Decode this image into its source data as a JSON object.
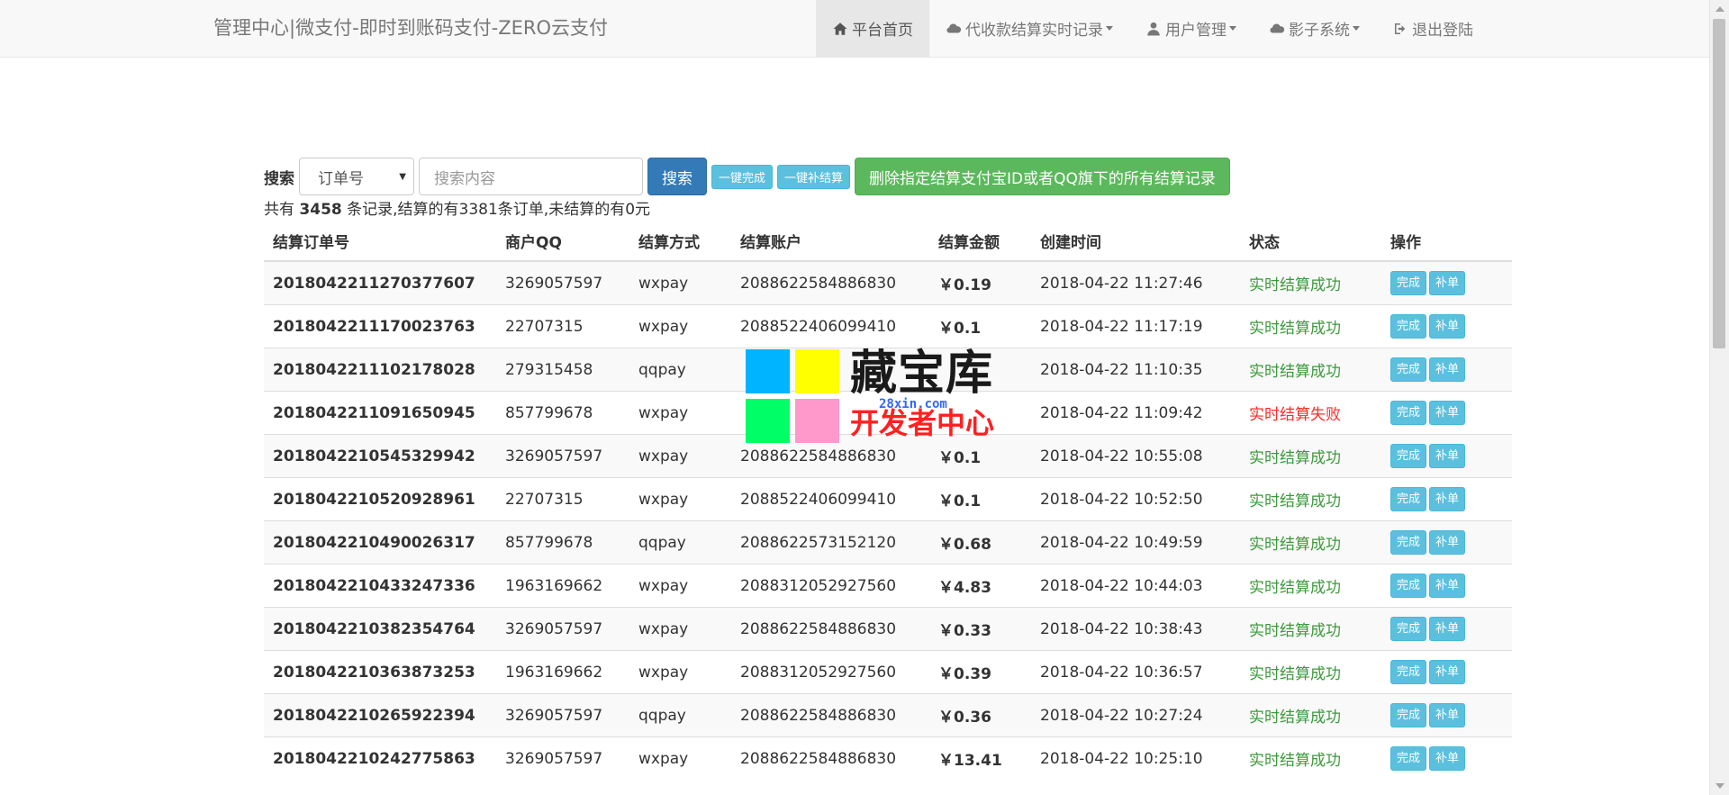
{
  "navbar": {
    "brand": "管理中心|微支付-即时到账码支付-ZERO云支付",
    "items": [
      {
        "label": "平台首页",
        "icon": "home-icon",
        "active": true,
        "dropdown": false
      },
      {
        "label": "代收款结算实时记录",
        "icon": "cloud-icon",
        "active": false,
        "dropdown": true
      },
      {
        "label": "用户管理",
        "icon": "user-icon",
        "active": false,
        "dropdown": true
      },
      {
        "label": "影子系统",
        "icon": "cloud-icon",
        "active": false,
        "dropdown": true
      },
      {
        "label": "退出登陆",
        "icon": "logout-icon",
        "active": false,
        "dropdown": false
      }
    ]
  },
  "search": {
    "label": "搜索",
    "select_value": "订单号",
    "placeholder": "搜索内容",
    "search_button": "搜索",
    "complete_all_button": "一键完成",
    "resettle_all_button": "一键补结算",
    "delete_button": "删除指定结算支付宝ID或者QQ旗下的所有结算记录"
  },
  "summary": {
    "prefix": "共有 ",
    "count": "3458",
    "suffix": " 条记录,结算的有3381条订单,未结算的有0元"
  },
  "table": {
    "headers": [
      "结算订单号",
      "商户QQ",
      "结算方式",
      "结算账户",
      "结算金额",
      "创建时间",
      "状态",
      "操作"
    ],
    "complete_label": "完成",
    "resettle_label": "补单",
    "rows": [
      {
        "order": "2018042211270377607",
        "qq": "3269057597",
        "method": "wxpay",
        "account": "2088622584886830",
        "amount": "￥0.19",
        "time": "2018-04-22 11:27:46",
        "status": "实时结算成功",
        "ok": true
      },
      {
        "order": "2018042211170023763",
        "qq": "22707315",
        "method": "wxpay",
        "account": "2088522406099410",
        "amount": "￥0.1",
        "time": "2018-04-22 11:17:19",
        "status": "实时结算成功",
        "ok": true
      },
      {
        "order": "2018042211102178028",
        "qq": "279315458",
        "method": "qqpay",
        "account": "",
        "amount": "",
        "time": "2018-04-22 11:10:35",
        "status": "实时结算成功",
        "ok": true
      },
      {
        "order": "2018042211091650945",
        "qq": "857799678",
        "method": "wxpay",
        "account": "",
        "amount": "",
        "time": "2018-04-22 11:09:42",
        "status": "实时结算失败",
        "ok": false
      },
      {
        "order": "2018042210545329942",
        "qq": "3269057597",
        "method": "wxpay",
        "account": "2088622584886830",
        "amount": "￥0.1",
        "time": "2018-04-22 10:55:08",
        "status": "实时结算成功",
        "ok": true
      },
      {
        "order": "2018042210520928961",
        "qq": "22707315",
        "method": "wxpay",
        "account": "2088522406099410",
        "amount": "￥0.1",
        "time": "2018-04-22 10:52:50",
        "status": "实时结算成功",
        "ok": true
      },
      {
        "order": "2018042210490026317",
        "qq": "857799678",
        "method": "qqpay",
        "account": "2088622573152120",
        "amount": "￥0.68",
        "time": "2018-04-22 10:49:59",
        "status": "实时结算成功",
        "ok": true
      },
      {
        "order": "2018042210433247336",
        "qq": "1963169662",
        "method": "wxpay",
        "account": "2088312052927560",
        "amount": "￥4.83",
        "time": "2018-04-22 10:44:03",
        "status": "实时结算成功",
        "ok": true
      },
      {
        "order": "2018042210382354764",
        "qq": "3269057597",
        "method": "wxpay",
        "account": "2088622584886830",
        "amount": "￥0.33",
        "time": "2018-04-22 10:38:43",
        "status": "实时结算成功",
        "ok": true
      },
      {
        "order": "2018042210363873253",
        "qq": "1963169662",
        "method": "wxpay",
        "account": "2088312052927560",
        "amount": "￥0.39",
        "time": "2018-04-22 10:36:57",
        "status": "实时结算成功",
        "ok": true
      },
      {
        "order": "2018042210265922394",
        "qq": "3269057597",
        "method": "qqpay",
        "account": "2088622584886830",
        "amount": "￥0.36",
        "time": "2018-04-22 10:27:24",
        "status": "实时结算成功",
        "ok": true
      },
      {
        "order": "2018042210242775863",
        "qq": "3269057597",
        "method": "wxpay",
        "account": "2088622584886830",
        "amount": "￥13.41",
        "time": "2018-04-22 10:25:10",
        "status": "实时结算成功",
        "ok": true
      }
    ]
  },
  "watermark": {
    "title": "藏宝库",
    "url": "28xin.com",
    "subtitle": "开发者中心"
  },
  "colors": {
    "success": "#3c9a3c",
    "fail": "#ff2a2a",
    "primary": "#337ab7",
    "info": "#5bc0de",
    "green_button": "#5cb85c"
  }
}
